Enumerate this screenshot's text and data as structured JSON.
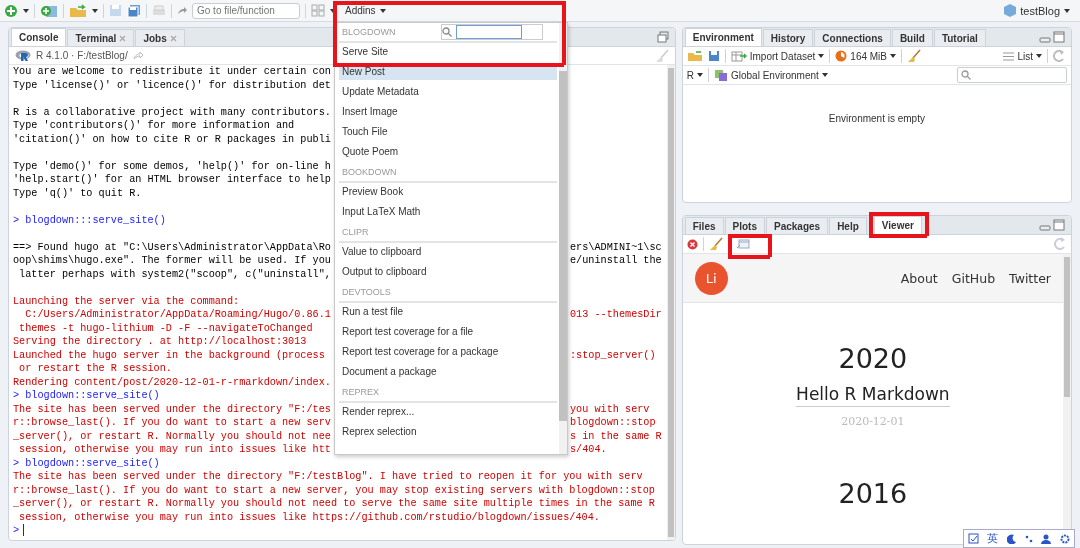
{
  "toolbar": {
    "goto_placeholder": "Go to file/function",
    "addins": {
      "label": "Addins",
      "highlighted": true
    },
    "project": "testBlog"
  },
  "addins_menu": {
    "items": [
      {
        "kind": "search_header",
        "label": "BLOGDOWN"
      },
      {
        "kind": "item",
        "label": "Serve Site",
        "selected": false
      },
      {
        "kind": "item",
        "label": "New Post",
        "selected": true
      },
      {
        "kind": "item",
        "label": "Update Metadata",
        "selected": false
      },
      {
        "kind": "item",
        "label": "Insert Image",
        "selected": false
      },
      {
        "kind": "item",
        "label": "Touch File",
        "selected": false
      },
      {
        "kind": "item",
        "label": "Quote Poem",
        "selected": false
      },
      {
        "kind": "header",
        "label": "BOOKDOWN"
      },
      {
        "kind": "item",
        "label": "Preview Book",
        "selected": false
      },
      {
        "kind": "item",
        "label": "Input LaTeX Math",
        "selected": false
      },
      {
        "kind": "header",
        "label": "CLIPR"
      },
      {
        "kind": "item",
        "label": "Value to clipboard",
        "selected": false
      },
      {
        "kind": "item",
        "label": "Output to clipboard",
        "selected": false
      },
      {
        "kind": "header",
        "label": "DEVTOOLS"
      },
      {
        "kind": "item",
        "label": "Run a test file",
        "selected": false
      },
      {
        "kind": "item",
        "label": "Report test coverage for a file",
        "selected": false
      },
      {
        "kind": "item",
        "label": "Report test coverage for a package",
        "selected": false
      },
      {
        "kind": "item",
        "label": "Document a package",
        "selected": false
      },
      {
        "kind": "header",
        "label": "REPREX"
      },
      {
        "kind": "item",
        "label": "Render reprex...",
        "selected": false
      },
      {
        "kind": "item",
        "label": "Reprex selection",
        "selected": false
      }
    ]
  },
  "console": {
    "tabs": [
      {
        "label": "Console",
        "selected": true,
        "closable": false
      },
      {
        "label": "Terminal",
        "selected": false,
        "closable": true
      },
      {
        "label": "Jobs",
        "selected": false,
        "closable": true
      }
    ],
    "session": "R 4.1.0 · F:/testBlog/",
    "lines": [
      {
        "kind": "output",
        "text": "You are welcome to redistribute it under certain con"
      },
      {
        "kind": "output",
        "text": "Type 'license()' or 'licence()' for distribution det"
      },
      {
        "kind": "blank"
      },
      {
        "kind": "output",
        "text": "R is a collaborative project with many contributors."
      },
      {
        "kind": "output",
        "text": "Type 'contributors()' for more information and"
      },
      {
        "kind": "output",
        "text": "'citation()' on how to cite R or R packages in publi"
      },
      {
        "kind": "blank"
      },
      {
        "kind": "output",
        "text": "Type 'demo()' for some demos, 'help()' for on-line h"
      },
      {
        "kind": "output",
        "text": "'help.start()' for an HTML browser interface to help"
      },
      {
        "kind": "output",
        "text": "Type 'q()' to quit R."
      },
      {
        "kind": "blank"
      },
      {
        "kind": "input",
        "text": "> blogdown:::serve_site()"
      },
      {
        "kind": "blank"
      },
      {
        "kind": "output",
        "text": "==> Found hugo at \"C:\\Users\\Administrator\\AppData\\Ro",
        "right": "ers\\ADMINI~1\\sc"
      },
      {
        "kind": "output",
        "text": "oop\\shims\\hugo.exe\". The former will be used. If you",
        "right": "e/uninstall the"
      },
      {
        "kind": "output",
        "text": " latter perhaps with system2(\"scoop\", c(\"uninstall\","
      },
      {
        "kind": "blank"
      },
      {
        "kind": "message",
        "text": "Launching the server via the command:"
      },
      {
        "kind": "message",
        "text": "  C:/Users/Administrator/AppData/Roaming/Hugo/0.86.1",
        "right": "013 --themesDir"
      },
      {
        "kind": "message",
        "text": " themes -t hugo-lithium -D -F --navigateToChanged"
      },
      {
        "kind": "message",
        "text": "Serving the directory . at http://localhost:3013"
      },
      {
        "kind": "message",
        "text": "Launched the hugo server in the background (process",
        "right": ":stop_server()"
      },
      {
        "kind": "message",
        "text": " or restart the R session."
      },
      {
        "kind": "message",
        "text": "Rendering content/post/2020-12-01-r-rmarkdown/index."
      },
      {
        "kind": "input",
        "text": "> blogdown::serve_site()"
      },
      {
        "kind": "message",
        "text": "The site has been served under the directory \"F:/tes",
        "right": "you with serv"
      },
      {
        "kind": "message",
        "text": "r::browse_last(). If you do want to start a new serv",
        "right": "blogdown::stop"
      },
      {
        "kind": "message",
        "text": "_server(), or restart R. Normally you should not nee",
        "right": "s in the same R"
      },
      {
        "kind": "message",
        "text": " session, otherwise you may run into issues like htt",
        "right": "s/404."
      },
      {
        "kind": "input",
        "text": "> blogdown::serve_site()"
      },
      {
        "kind": "message",
        "text": "The site has been served under the directory \"F:/testBlog\". I have tried to reopen it for you with serv"
      },
      {
        "kind": "message",
        "text": "r::browse_last(). If you do want to start a new server, you may stop existing servers with blogdown::stop"
      },
      {
        "kind": "message",
        "text": "_server(), or restart R. Normally you should not need to serve the same site multiple times in the same R"
      },
      {
        "kind": "message",
        "text": " session, otherwise you may run into issues like https://github.com/rstudio/blogdown/issues/404."
      },
      {
        "kind": "prompt",
        "text": ">"
      }
    ]
  },
  "environment": {
    "tabs": [
      {
        "label": "Environment",
        "selected": true
      },
      {
        "label": "History",
        "selected": false
      },
      {
        "label": "Connections",
        "selected": false
      },
      {
        "label": "Build",
        "selected": false
      },
      {
        "label": "Tutorial",
        "selected": false
      }
    ],
    "import_label": "Import Dataset",
    "memory": "164 MiB",
    "view": "List",
    "language": "R",
    "scope": "Global Environment",
    "empty_message": "Environment is empty"
  },
  "viewer": {
    "tabs": [
      {
        "label": "Files",
        "selected": false,
        "highlighted": false
      },
      {
        "label": "Plots",
        "selected": false,
        "highlighted": false
      },
      {
        "label": "Packages",
        "selected": false,
        "highlighted": false
      },
      {
        "label": "Help",
        "selected": false,
        "highlighted": false
      },
      {
        "label": "Viewer",
        "selected": true,
        "highlighted": true
      }
    ],
    "popout_highlighted": true,
    "site": {
      "logo": "Li",
      "nav": [
        "About",
        "GitHub",
        "Twitter"
      ],
      "posts": [
        {
          "year": "2020",
          "title": "Hello R Markdown",
          "date": "2020-12-01"
        },
        {
          "year": "2016"
        }
      ]
    }
  },
  "ime_bar": {
    "language": "英"
  }
}
